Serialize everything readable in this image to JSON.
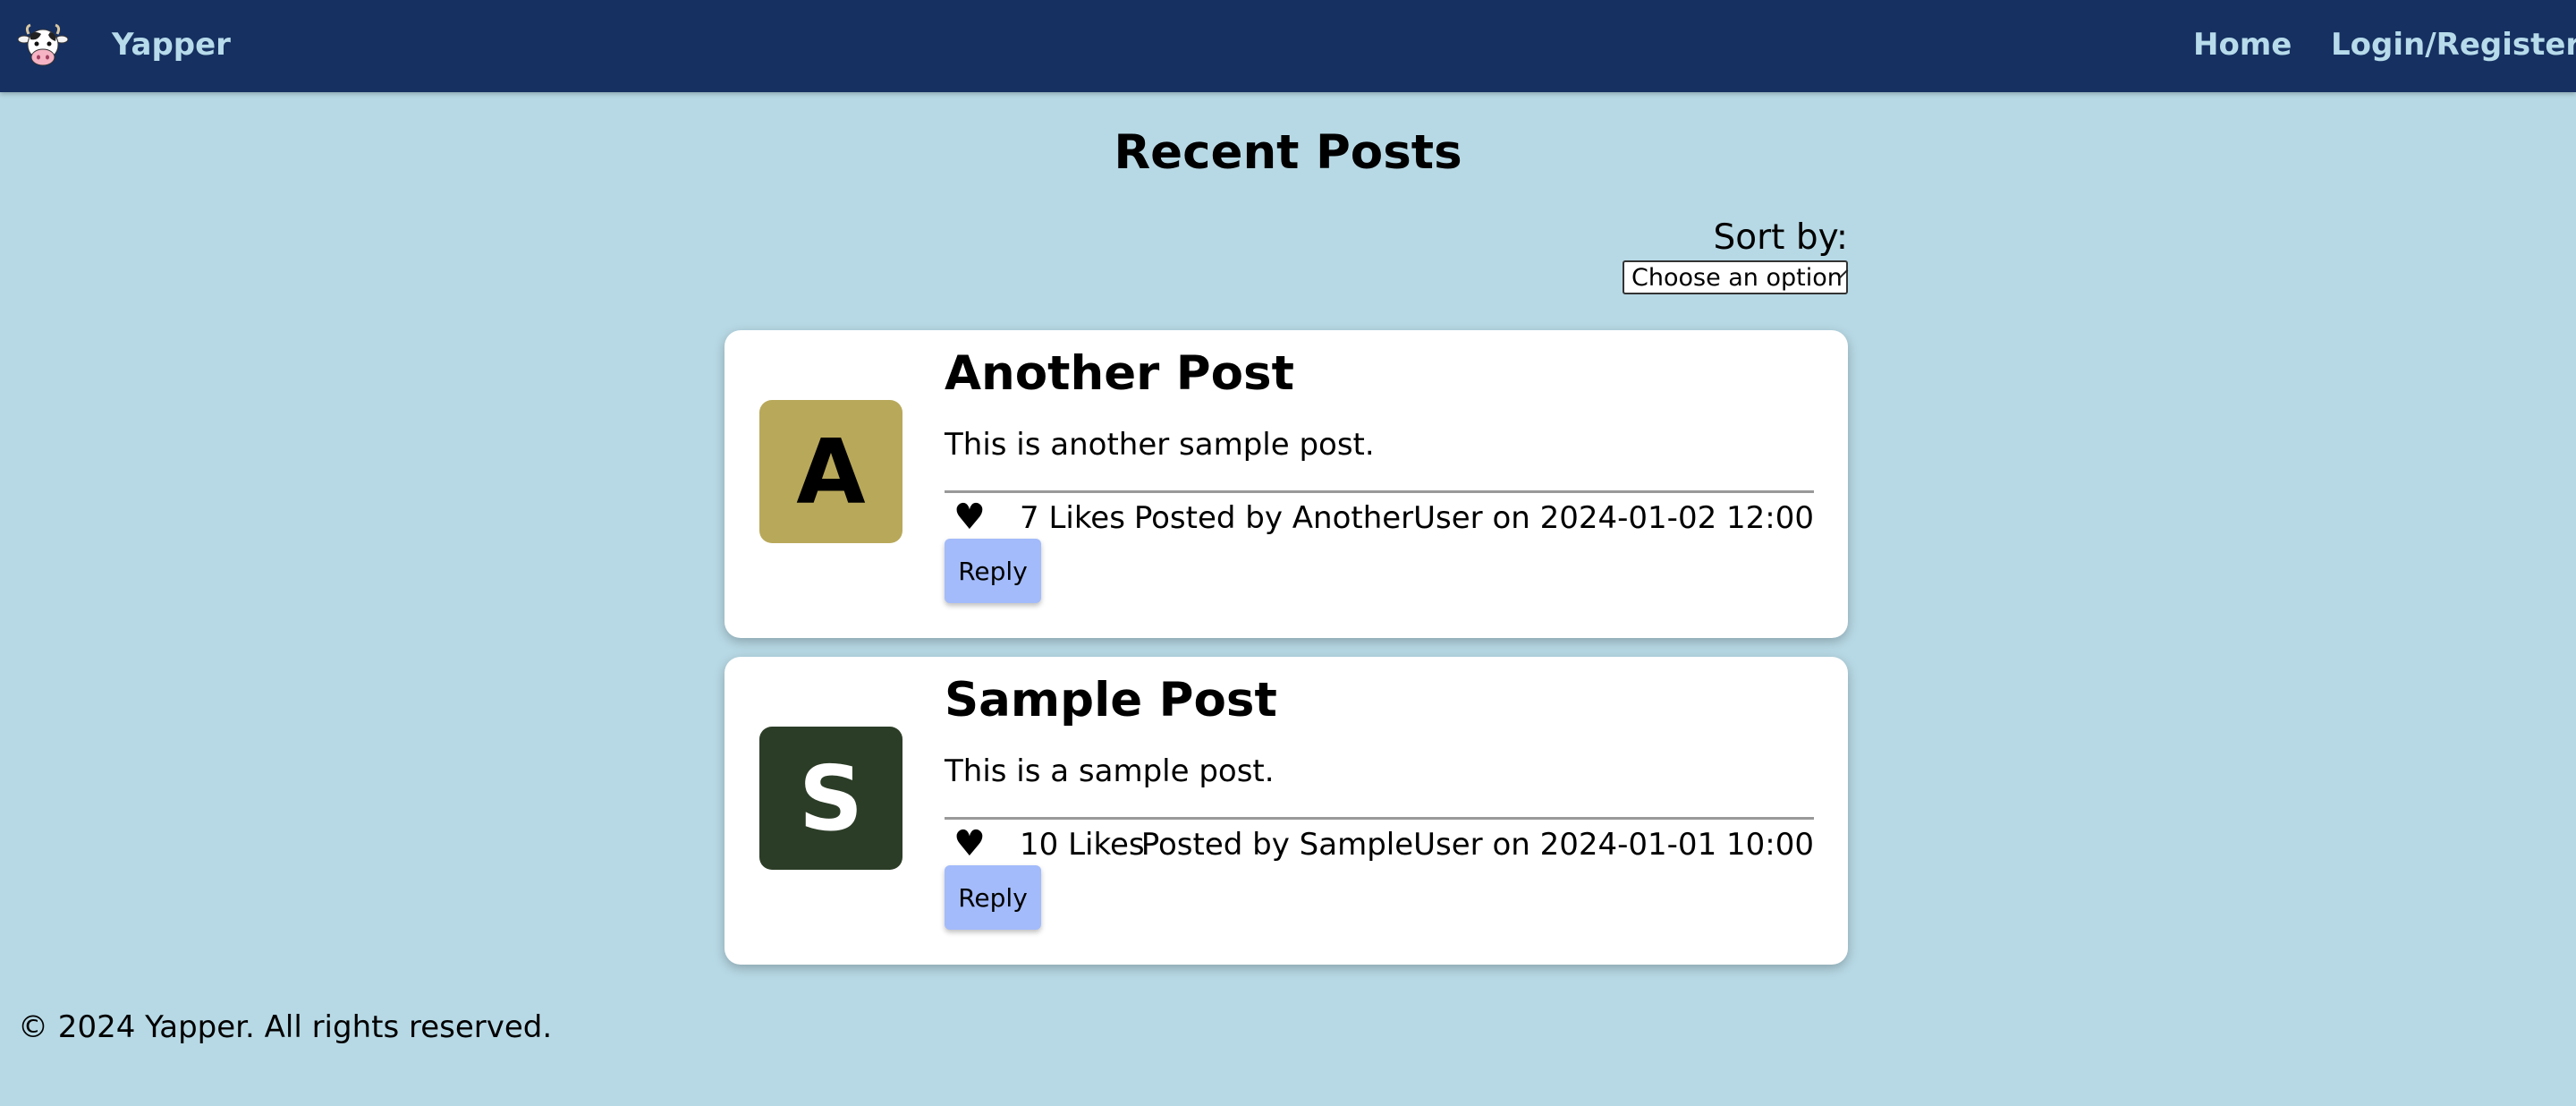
{
  "nav": {
    "logo_icon": "cow-icon",
    "brand": "Yapper",
    "home": "Home",
    "login": "Login/Register"
  },
  "main": {
    "title": "Recent Posts",
    "sort_label": "Sort by:",
    "sort_selected": "Choose an option"
  },
  "posts": [
    {
      "avatar_letter": "A",
      "avatar_color": "#b8a85a",
      "avatar_text_color": "#000000",
      "title": "Another Post",
      "body": "This is another sample post.",
      "heart": "♥",
      "likes": "7 Likes",
      "meta": "Posted by AnotherUser on 2024-01-02 12:00",
      "reply": "Reply"
    },
    {
      "avatar_letter": "S",
      "avatar_color": "#2c3d27",
      "avatar_text_color": "#ffffff",
      "title": "Sample Post",
      "body": "This is a sample post.",
      "heart": "♥",
      "likes": "10 Likes",
      "meta": "Posted by SampleUser on 2024-01-01 10:00",
      "reply": "Reply"
    }
  ],
  "footer": {
    "text": "© 2024 Yapper. All rights reserved."
  },
  "colors": {
    "navbar": "#163061",
    "nav_text": "#b7dbea",
    "background": "#b7d9e5",
    "reply_button": "#a3bbfa"
  }
}
